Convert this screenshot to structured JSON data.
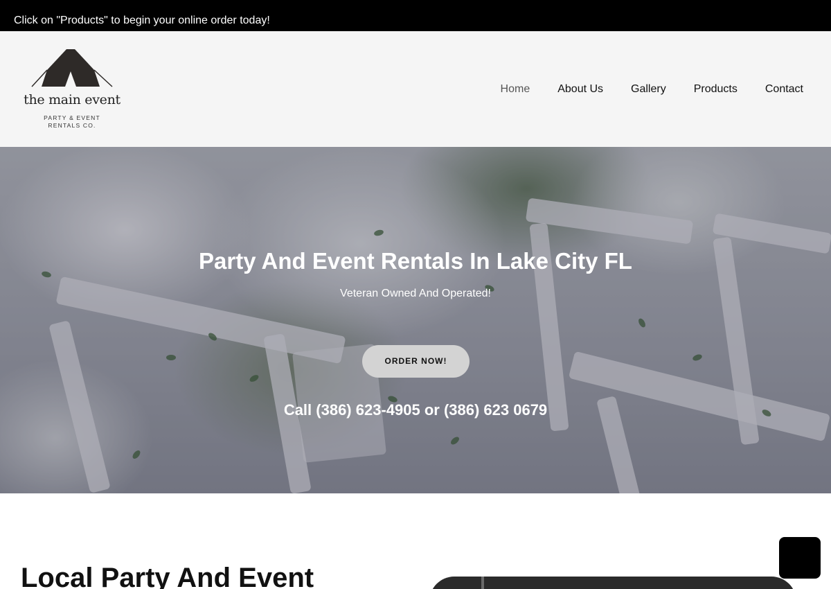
{
  "announcement": {
    "text": "Click on \"Products\" to begin your online order today!"
  },
  "logo": {
    "name": "the main event",
    "tagline_line1": "PARTY & EVENT",
    "tagline_line2": "RENTALS CO.",
    "icon": "tent-icon"
  },
  "nav": {
    "items": [
      {
        "label": "Home",
        "active": true
      },
      {
        "label": "About Us",
        "active": false
      },
      {
        "label": "Gallery",
        "active": false
      },
      {
        "label": "Products",
        "active": false
      },
      {
        "label": "Contact",
        "active": false
      }
    ]
  },
  "hero": {
    "title": "Party And Event Rentals In Lake City FL",
    "subtitle": "Veteran Owned And Operated!",
    "cta_label": "ORDER NOW!",
    "call_text": "Call (386) 623-4905 or (386) 623 0679"
  },
  "section": {
    "heading": "Local Party And Event"
  },
  "colors": {
    "announcement_bg": "#000000",
    "header_bg": "#f5f5f5",
    "cta_bg": "#d3d3d3",
    "chat_widget_bg": "#000000"
  }
}
